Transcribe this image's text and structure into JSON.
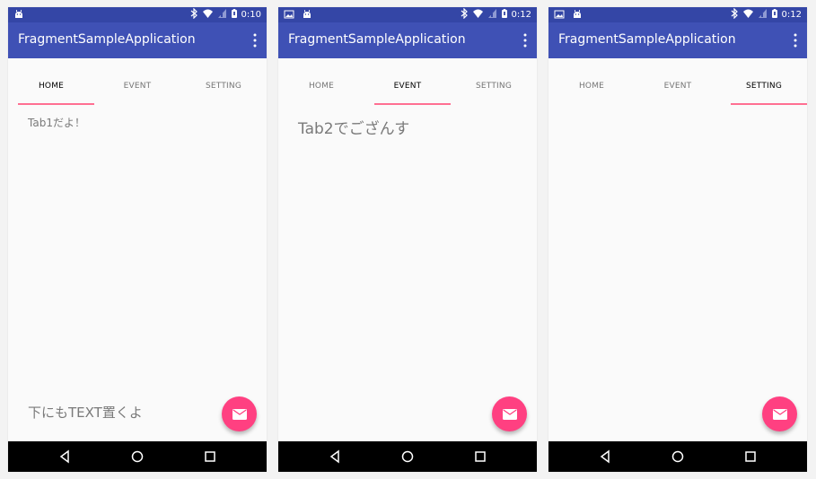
{
  "colors": {
    "status_bar": "#3446a6",
    "app_bar": "#3f51b5",
    "indicator": "#ff6f92",
    "fab": "#ff4081"
  },
  "screens": [
    {
      "time": "0:10",
      "app_title": "FragmentSampleApplication",
      "tabs": [
        "HOME",
        "EVENT",
        "SETTING"
      ],
      "active_tab": "HOME",
      "content_text": "Tab1だよ！",
      "bottom_text": "下にもTEXT置くよ"
    },
    {
      "time": "0:12",
      "app_title": "FragmentSampleApplication",
      "tabs": [
        "HOME",
        "EVENT",
        "SETTING"
      ],
      "active_tab": "EVENT",
      "content_text": "Tab2でござんす"
    },
    {
      "time": "0:12",
      "app_title": "FragmentSampleApplication",
      "tabs": [
        "HOME",
        "EVENT",
        "SETTING"
      ],
      "active_tab": "SETTING"
    }
  ],
  "icons": {
    "android": "android-icon",
    "image": "image-icon",
    "bluetooth": "bluetooth-icon",
    "wifi": "wifi-icon",
    "signal": "signal-icon",
    "battery": "battery-icon",
    "overflow": "more-vert-icon",
    "fab": "mail-icon",
    "back": "back-icon",
    "home": "home-icon",
    "recents": "recents-icon"
  }
}
